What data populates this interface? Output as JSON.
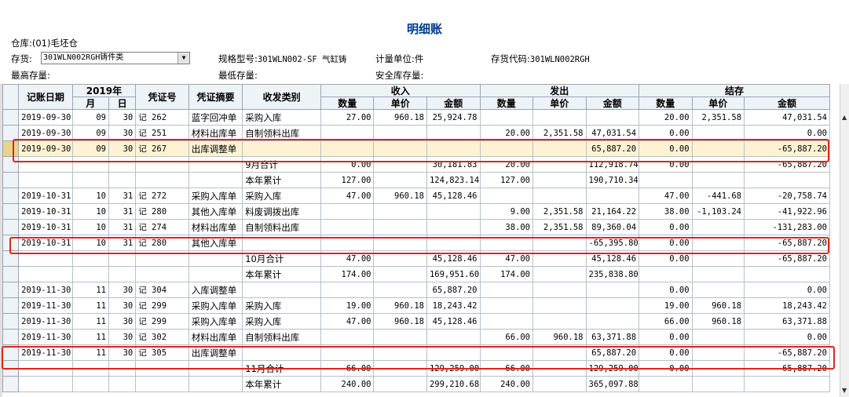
{
  "report": {
    "title": "明细账",
    "warehouse_label": "仓库:",
    "warehouse_value": "(01)毛坯仓",
    "inventory_label": "存货:",
    "inventory_value": "301WLN002RGH铸件类",
    "spec_label": "规格型号:",
    "spec_value": "301WLN002-SF 气缸铸",
    "unit_label": "计量单位:",
    "unit_value": "件",
    "code_label": "存货代码:",
    "code_value": "301WLN002RGH",
    "max_stock_label": "最高存量:",
    "min_stock_label": "最低存量:",
    "safe_stock_label": "安全库存量:"
  },
  "table": {
    "headers": {
      "date": "记账日期",
      "year": "2019年",
      "month": "月",
      "day": "日",
      "voucher": "凭证号",
      "summary": "凭证摘要",
      "category": "收发类别",
      "in": "收入",
      "out": "发出",
      "balance": "结存",
      "qty": "数量",
      "price": "单价",
      "amount": "金额"
    },
    "rows": [
      [
        "2019-09-30",
        "09",
        "30",
        "记 262",
        "蓝字回冲单",
        "采购入库",
        "27.00",
        "960.18",
        "25,924.78",
        "",
        "",
        "",
        "20.00",
        "2,351.58",
        "47,031.54"
      ],
      [
        "2019-09-30",
        "09",
        "30",
        "记 251",
        "材料出库单",
        "自制领料出库",
        "",
        "",
        "",
        "20.00",
        "2,351.58",
        "47,031.54",
        "0.00",
        "",
        "0.00"
      ],
      [
        "2019-09-30",
        "09",
        "30",
        "记 267",
        "出库调整单",
        "",
        "",
        "",
        "",
        "",
        "",
        "65,887.20",
        "0.00",
        "",
        "-65,887.20"
      ],
      [
        "",
        "",
        "",
        "",
        "",
        "9月合计",
        "0.00",
        "",
        "30,181.83",
        "20.00",
        "",
        "112,918.74",
        "0.00",
        "",
        "-65,887.20"
      ],
      [
        "",
        "",
        "",
        "",
        "",
        "本年累计",
        "127.00",
        "",
        "124,823.14",
        "127.00",
        "",
        "190,710.34",
        "",
        "",
        ""
      ],
      [
        "2019-10-31",
        "10",
        "31",
        "记 272",
        "采购入库单",
        "采购入库",
        "47.00",
        "960.18",
        "45,128.46",
        "",
        "",
        "",
        "47.00",
        "-441.68",
        "-20,758.74"
      ],
      [
        "2019-10-31",
        "10",
        "31",
        "记 280",
        "其他入库单",
        "料废调拨出库",
        "",
        "",
        "",
        "9.00",
        "2,351.58",
        "21,164.22",
        "38.00",
        "-1,103.24",
        "-41,922.96"
      ],
      [
        "2019-10-31",
        "10",
        "31",
        "记 274",
        "材料出库单",
        "自制领料出库",
        "",
        "",
        "",
        "38.00",
        "2,351.58",
        "89,360.04",
        "0.00",
        "",
        "-131,283.00"
      ],
      [
        "2019-10-31",
        "10",
        "31",
        "记 280",
        "其他入库单",
        "",
        "",
        "",
        "",
        "",
        "",
        "-65,395.80",
        "0.00",
        "",
        "-65,887.20"
      ],
      [
        "",
        "",
        "",
        "",
        "",
        "10月合计",
        "47.00",
        "",
        "45,128.46",
        "47.00",
        "",
        "45,128.46",
        "0.00",
        "",
        "-65,887.20"
      ],
      [
        "",
        "",
        "",
        "",
        "",
        "本年累计",
        "174.00",
        "",
        "169,951.60",
        "174.00",
        "",
        "235,838.80",
        "",
        "",
        ""
      ],
      [
        "2019-11-30",
        "11",
        "30",
        "记 304",
        "入库调整单",
        "",
        "",
        "",
        "65,887.20",
        "",
        "",
        "",
        "0.00",
        "",
        "0.00"
      ],
      [
        "2019-11-30",
        "11",
        "30",
        "记 299",
        "采购入库单",
        "采购入库",
        "19.00",
        "960.18",
        "18,243.42",
        "",
        "",
        "",
        "19.00",
        "960.18",
        "18,243.42"
      ],
      [
        "2019-11-30",
        "11",
        "30",
        "记 299",
        "采购入库单",
        "采购入库",
        "47.00",
        "960.18",
        "45,128.46",
        "",
        "",
        "",
        "66.00",
        "960.18",
        "63,371.88"
      ],
      [
        "2019-11-30",
        "11",
        "30",
        "记 302",
        "材料出库单",
        "自制领料出库",
        "",
        "",
        "",
        "66.00",
        "960.18",
        "63,371.88",
        "0.00",
        "",
        "0.00"
      ],
      [
        "2019-11-30",
        "11",
        "30",
        "记 305",
        "出库调整单",
        "",
        "",
        "",
        "",
        "",
        "",
        "65,887.20",
        "0.00",
        "",
        "-65,887.20"
      ],
      [
        "",
        "",
        "",
        "",
        "",
        "11月合计",
        "66.00",
        "",
        "129,259.00",
        "66.00",
        "",
        "129,259.00",
        "0.00",
        "",
        "-65,887.20"
      ],
      [
        "",
        "",
        "",
        "",
        "",
        "本年累计",
        "240.00",
        "",
        "299,210.68",
        "240.00",
        "",
        "365,097.88",
        "",
        "",
        ""
      ]
    ]
  }
}
